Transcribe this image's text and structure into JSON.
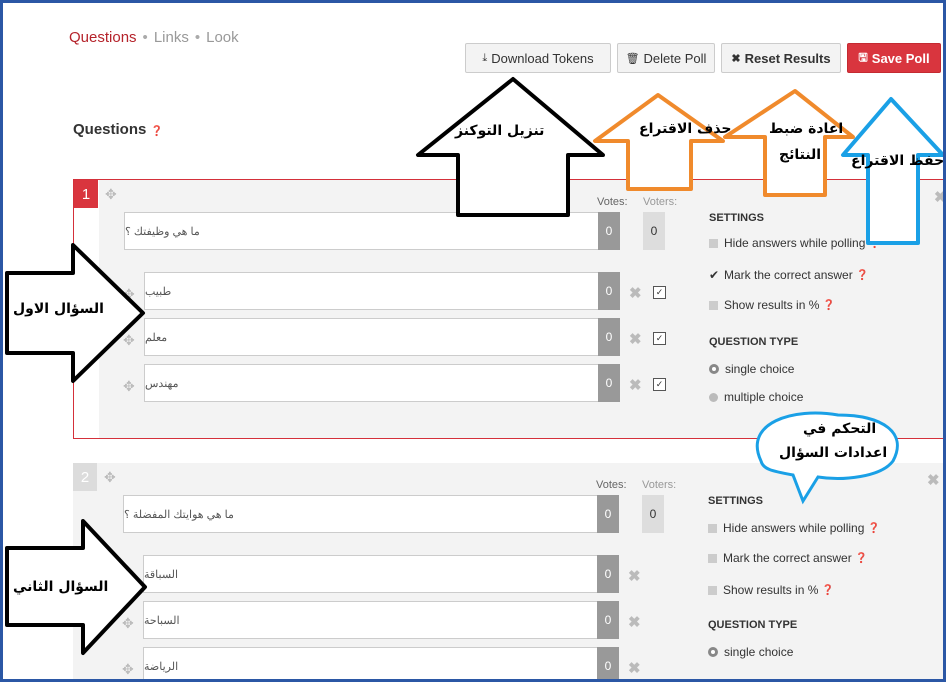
{
  "nav": {
    "crumb_questions": "Questions",
    "crumb_links": "Links",
    "crumb_look": "Look",
    "sep": "•"
  },
  "toolbar": {
    "download_label": "Download Tokens",
    "delete_label": "Delete Poll",
    "reset_label": "Reset Results",
    "save_label": "Save Poll"
  },
  "page_heading": "Questions",
  "col_votes": "Votes:",
  "col_voters": "Voters:",
  "settings_heading": "SETTINGS",
  "question_type_heading": "QUESTION TYPE",
  "questions": [
    {
      "number": "1",
      "text": "ما هي وظيفتك ؟",
      "votes": "0",
      "voters": "0",
      "answers": [
        {
          "text": "طبيب",
          "count": "0"
        },
        {
          "text": "معلم",
          "count": "0"
        },
        {
          "text": "مهندس",
          "count": "0"
        }
      ],
      "settings": {
        "hide": "Hide answers while polling",
        "mark": "Mark the correct answer",
        "show": "Show results in %",
        "single": "single choice",
        "multiple": "multiple choice"
      }
    },
    {
      "number": "2",
      "text": "ما هي هوايتك المفضلة ؟",
      "votes": "0",
      "voters": "0",
      "answers": [
        {
          "text": "السباقة",
          "count": "0"
        },
        {
          "text": "السباحة",
          "count": "0"
        },
        {
          "text": "الرياضة",
          "count": "0"
        }
      ],
      "settings": {
        "hide": "Hide answers while polling",
        "mark": "Mark the correct answer",
        "show": "Show results in %",
        "single": "single choice"
      }
    }
  ],
  "annotations": {
    "download": "تنزيل التوكنز",
    "delete": "حذف الاقتراع",
    "reset_1": "اعادة ضبط",
    "reset_2": "النتائج",
    "save": "حفظ الاقتراع",
    "q1": "السؤال الاول",
    "q2": "السؤال الثاني",
    "settings_1": "التحكم في",
    "settings_2": "اعدادات السؤال"
  },
  "colors": {
    "accent_red": "#d9353e",
    "frame_blue": "#2b57a5",
    "arrow_orange": "#f08a2c",
    "arrow_blue": "#1aa0e6"
  },
  "icons": [
    "download-icon",
    "trash-icon",
    "times-icon",
    "floppy-icon",
    "question-circle-icon",
    "move-icon",
    "close-icon",
    "checkbox-icon"
  ]
}
